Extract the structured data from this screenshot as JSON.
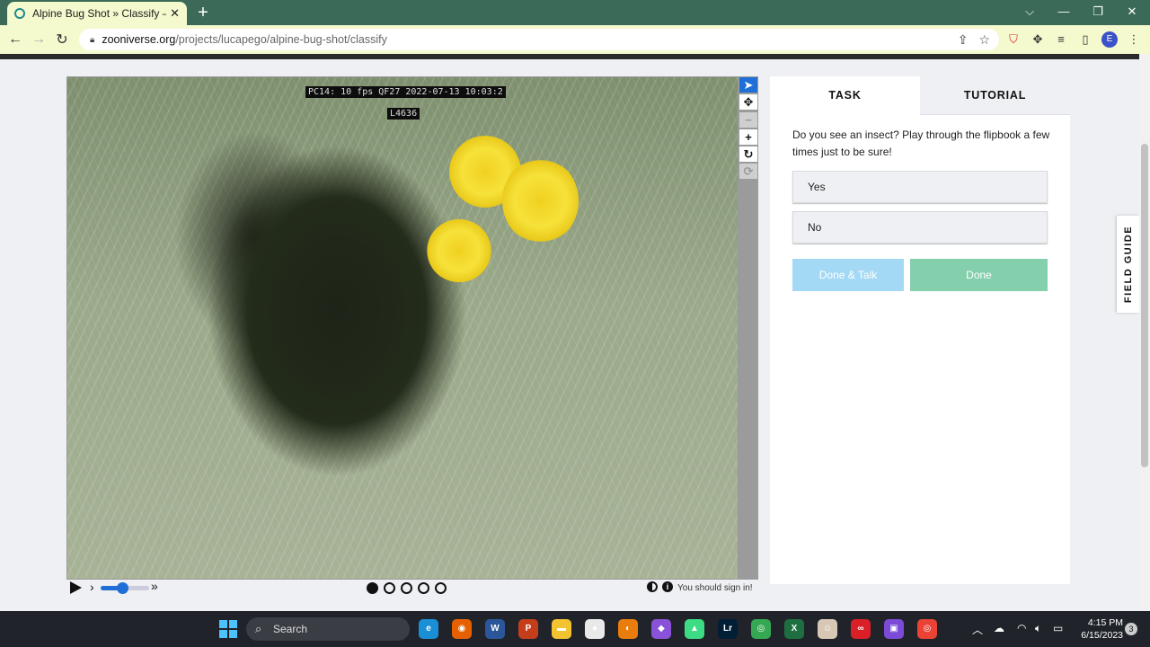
{
  "browser": {
    "tab_title": "Alpine Bug Shot » Classify — Zoo",
    "tab_close": "✕",
    "new_tab": "+",
    "url_host": "zooniverse.org",
    "url_path": "/projects/lucapego/alpine-bug-shot/classify",
    "profile_initial": "E",
    "window_controls": [
      "⌵",
      "—",
      "❐",
      "✕"
    ]
  },
  "viewer": {
    "camera_stamp": "PC14: 10 fps  QF27  2022-07-13  10:03:2",
    "frame_stamp": "L4636",
    "tools": [
      "pointer",
      "pan",
      "zoom-out",
      "zoom-in",
      "rotate",
      "reset"
    ],
    "playback_speed_fraction": 0.45,
    "frame_count": 5,
    "current_frame": 1,
    "sign_in_text": "You should sign in!"
  },
  "panel": {
    "tabs": [
      "TASK",
      "TUTORIAL"
    ],
    "active_tab": "TASK",
    "question": "Do you see an insect? Play through the flipbook a few times just to be sure!",
    "answers": [
      "Yes",
      "No"
    ],
    "done_talk_label": "Done & Talk",
    "done_label": "Done",
    "field_guide_label": "FIELD GUIDE"
  },
  "taskbar": {
    "search_label": "Search",
    "time": "4:15 PM",
    "date": "6/15/2023",
    "notifications": "3",
    "apps": [
      {
        "name": "edge",
        "glyph": "e",
        "color": "#1b8fd6"
      },
      {
        "name": "firefox",
        "glyph": "◉",
        "color": "#e66000"
      },
      {
        "name": "word",
        "glyph": "W",
        "color": "#2b579a"
      },
      {
        "name": "powerpoint",
        "glyph": "P",
        "color": "#c43e1c"
      },
      {
        "name": "file-explorer",
        "glyph": "▬",
        "color": "#f2c231"
      },
      {
        "name": "penguin-app",
        "glyph": "●",
        "color": "#e9e9e9"
      },
      {
        "name": "blender",
        "glyph": "◐",
        "color": "#e87d0d"
      },
      {
        "name": "drop-app",
        "glyph": "◆",
        "color": "#8a52d8"
      },
      {
        "name": "android-studio",
        "glyph": "▲",
        "color": "#3ddc84"
      },
      {
        "name": "lightroom",
        "glyph": "Lr",
        "color": "#001e36"
      },
      {
        "name": "chrome",
        "glyph": "◎",
        "color": "#34a853"
      },
      {
        "name": "excel",
        "glyph": "X",
        "color": "#1d6f42"
      },
      {
        "name": "character-app",
        "glyph": "☺",
        "color": "#d8c7b5"
      },
      {
        "name": "creative-cloud",
        "glyph": "∞",
        "color": "#da1f26"
      },
      {
        "name": "clipchamp",
        "glyph": "▣",
        "color": "#7b4bd8"
      },
      {
        "name": "chrome-profile",
        "glyph": "◎",
        "color": "#ea4335"
      }
    ]
  }
}
